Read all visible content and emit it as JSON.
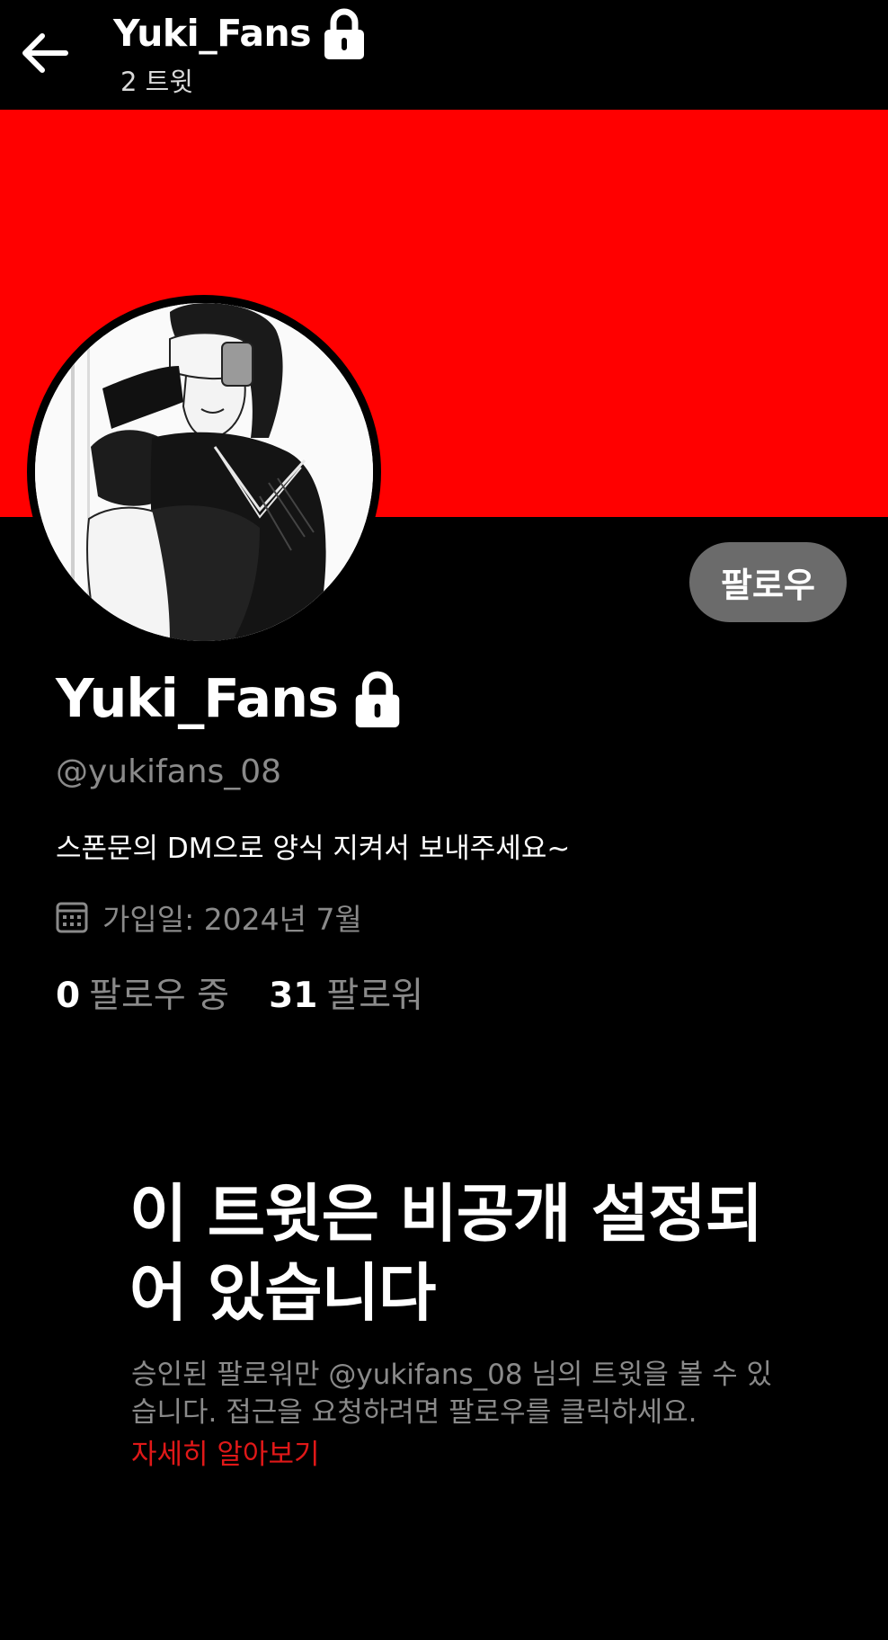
{
  "colors": {
    "banner": "#ff0000",
    "background": "#000000",
    "link": "#e01818",
    "muted": "#8a8a8a",
    "follow_button_bg": "#6b6b6b"
  },
  "header": {
    "back_icon": "arrow-left-icon",
    "title": "Yuki_Fans",
    "lock_icon": "lock-icon",
    "tweet_count": "2 트윗"
  },
  "profile": {
    "avatar_icon": "manga-girl-avatar",
    "follow_label": "팔로우",
    "name": "Yuki_Fans",
    "handle": "@yukifans_08",
    "bio": "스폰문의 DM으로 양식 지켜서 보내주세요~",
    "calendar_icon": "calendar-icon",
    "joined": "가입일: 2024년 7월",
    "following_count": "0",
    "following_label": "팔로우 중",
    "followers_count": "31",
    "followers_label": "팔로워"
  },
  "private_notice": {
    "title": "이 트윗은 비공개 설정되어 있습니다",
    "description": "승인된 팔로워만 @yukifans_08 님의 트윗을 볼 수 있습니다. 접근을 요청하려면 팔로우를 클릭하세요.",
    "learn_more": "자세히 알아보기"
  }
}
